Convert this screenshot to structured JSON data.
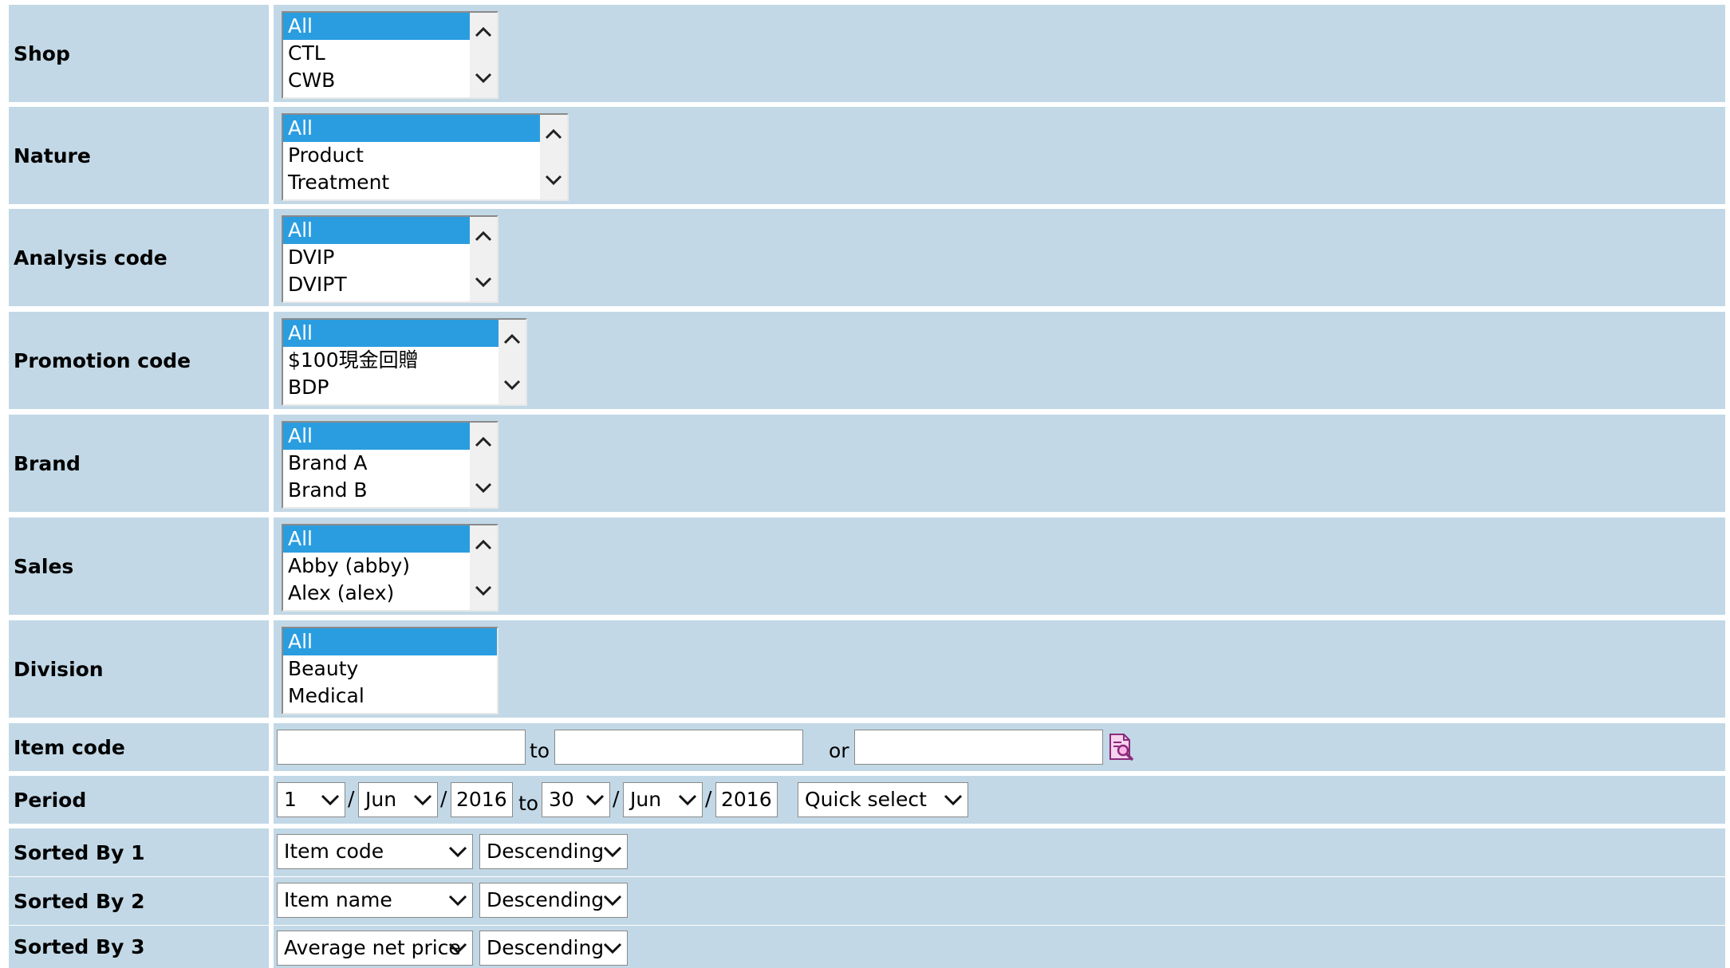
{
  "labels": {
    "shop": "Shop",
    "nature": "Nature",
    "analysis_code": "Analysis code",
    "promotion_code": "Promotion code",
    "brand": "Brand",
    "sales": "Sales",
    "division": "Division",
    "item_code": "Item code",
    "period": "Period",
    "sorted_by_1": "Sorted By 1",
    "sorted_by_2": "Sorted By 2",
    "sorted_by_3": "Sorted By 3"
  },
  "shop": {
    "options": [
      "All",
      "CTL",
      "CWB"
    ],
    "selected": "All"
  },
  "nature": {
    "options": [
      "All",
      "Product",
      "Treatment"
    ],
    "selected": "All"
  },
  "analysis_code": {
    "options": [
      "All",
      "DVIP",
      "DVIPT"
    ],
    "selected": "All"
  },
  "promotion_code": {
    "options": [
      "All",
      "$100現金回贈",
      "BDP"
    ],
    "selected": "All"
  },
  "brand": {
    "options": [
      "All",
      "Brand A",
      "Brand B"
    ],
    "selected": "All"
  },
  "sales": {
    "options": [
      "All",
      "Abby (abby)",
      "Alex (alex)"
    ],
    "selected": "All"
  },
  "division": {
    "options": [
      "All",
      "Beauty",
      "Medical"
    ],
    "selected": "All"
  },
  "item_code": {
    "from": "",
    "to_label": "to",
    "to": "",
    "or_label": "or",
    "or_value": "",
    "search_icon": "search-document-icon"
  },
  "period": {
    "from_day": "1",
    "from_month": "Jun",
    "from_year": "2016",
    "to_label": "to",
    "to_day": "30",
    "to_month": "Jun",
    "to_year": "2016",
    "separator": "/",
    "quick_select": "Quick select"
  },
  "sorted_by_1": {
    "field": "Item code",
    "order": "Descending"
  },
  "sorted_by_2": {
    "field": "Item name",
    "order": "Descending"
  },
  "sorted_by_3": {
    "field": "Average net price",
    "order": "Descending"
  },
  "colors": {
    "row_bg": "#c2d8e6",
    "selected_bg": "#2a9de0"
  }
}
